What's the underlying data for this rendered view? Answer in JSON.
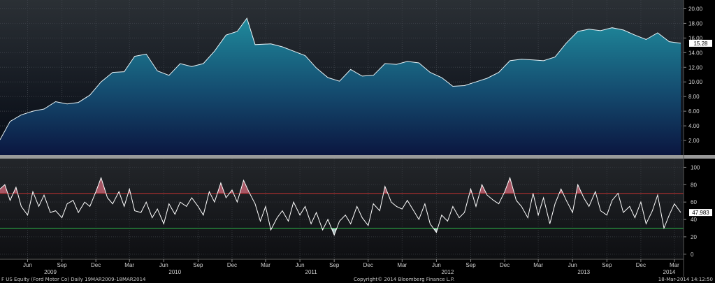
{
  "chart_data": [
    {
      "type": "area",
      "title": "",
      "security": "F US Equity (Ford Motor Co)",
      "periodicity": "Daily",
      "ylim": [
        0,
        21
      ],
      "yticks": [
        2,
        4,
        6,
        8,
        10,
        12,
        14,
        16,
        18,
        20
      ],
      "ytick_labels": [
        "2.00",
        "4.00",
        "6.00",
        "8.00",
        "10.00",
        "12.00",
        "14.00",
        "16.00",
        "18.00",
        "20.00"
      ],
      "last_value": 15.28,
      "last_value_label": "15.28",
      "grid": true,
      "colors": {
        "area_top": "#1f8a9c",
        "area_bottom": "#0b1640",
        "line": "#e8f4f8",
        "background_top": "#2b3035",
        "background_bottom": "#050a14"
      },
      "x": [
        "2009-03-19",
        "2009-04-15",
        "2009-05-15",
        "2009-06-15",
        "2009-07-15",
        "2009-08-15",
        "2009-09-15",
        "2009-10-15",
        "2009-11-15",
        "2009-12-15",
        "2010-01-15",
        "2010-02-15",
        "2010-03-15",
        "2010-04-15",
        "2010-05-15",
        "2010-06-15",
        "2010-07-15",
        "2010-08-15",
        "2010-09-15",
        "2010-10-15",
        "2010-11-15",
        "2010-12-15",
        "2011-01-10",
        "2011-02-01",
        "2011-03-15",
        "2011-04-15",
        "2011-05-15",
        "2011-06-15",
        "2011-07-15",
        "2011-08-15",
        "2011-09-15",
        "2011-10-15",
        "2011-11-15",
        "2011-12-15",
        "2012-01-15",
        "2012-02-15",
        "2012-03-15",
        "2012-04-15",
        "2012-05-15",
        "2012-06-15",
        "2012-07-15",
        "2012-08-15",
        "2012-09-15",
        "2012-10-15",
        "2012-11-15",
        "2012-12-15",
        "2013-01-15",
        "2013-02-15",
        "2013-03-15",
        "2013-04-15",
        "2013-05-15",
        "2013-06-15",
        "2013-07-15",
        "2013-08-15",
        "2013-09-15",
        "2013-10-15",
        "2013-11-15",
        "2013-12-15",
        "2014-01-15",
        "2014-02-15",
        "2014-03-18"
      ],
      "values": [
        2.1,
        4.6,
        5.5,
        6.0,
        6.3,
        7.3,
        7.0,
        7.2,
        8.2,
        10.0,
        11.3,
        11.4,
        13.5,
        13.8,
        11.5,
        10.9,
        12.5,
        12.1,
        12.5,
        14.2,
        16.4,
        16.9,
        18.7,
        15.1,
        15.2,
        14.8,
        14.2,
        13.6,
        11.9,
        10.6,
        10.1,
        11.7,
        10.8,
        10.9,
        12.5,
        12.4,
        12.8,
        12.6,
        11.3,
        10.6,
        9.4,
        9.5,
        10.0,
        10.5,
        11.3,
        12.9,
        13.1,
        13.0,
        12.9,
        13.4,
        15.3,
        16.9,
        17.2,
        17.0,
        17.4,
        17.1,
        16.4,
        15.8,
        16.7,
        15.5,
        15.28
      ]
    },
    {
      "type": "line",
      "title": "",
      "ylim": [
        -5,
        110
      ],
      "yticks": [
        0,
        20,
        40,
        60,
        80,
        100
      ],
      "ytick_labels": [
        "0",
        "20",
        "40",
        "60",
        "80",
        "100"
      ],
      "overbought_level": 70,
      "oversold_level": 30,
      "last_value": 47.983,
      "last_value_label": "47.983",
      "grid": true,
      "colors": {
        "line": "#ffffff",
        "overbought": "#c23030",
        "oversold": "#2fb84a",
        "fill_over": "#c06070",
        "fill_under": "#cfe8e8"
      },
      "x": [
        "2009-03-19",
        "2009-04-01",
        "2009-04-15",
        "2009-05-01",
        "2009-05-15",
        "2009-06-01",
        "2009-06-15",
        "2009-07-01",
        "2009-07-15",
        "2009-08-01",
        "2009-08-15",
        "2009-09-01",
        "2009-09-15",
        "2009-10-01",
        "2009-10-15",
        "2009-11-01",
        "2009-11-15",
        "2009-12-01",
        "2009-12-15",
        "2010-01-01",
        "2010-01-15",
        "2010-02-01",
        "2010-02-15",
        "2010-03-01",
        "2010-03-15",
        "2010-04-01",
        "2010-04-15",
        "2010-05-01",
        "2010-05-15",
        "2010-06-01",
        "2010-06-15",
        "2010-07-01",
        "2010-07-15",
        "2010-08-01",
        "2010-08-15",
        "2010-09-01",
        "2010-09-15",
        "2010-10-01",
        "2010-10-15",
        "2010-11-01",
        "2010-11-15",
        "2010-12-01",
        "2010-12-15",
        "2011-01-01",
        "2011-01-15",
        "2011-02-01",
        "2011-02-15",
        "2011-03-01",
        "2011-03-15",
        "2011-04-01",
        "2011-04-15",
        "2011-05-01",
        "2011-05-15",
        "2011-06-01",
        "2011-06-15",
        "2011-07-01",
        "2011-07-15",
        "2011-08-01",
        "2011-08-15",
        "2011-09-01",
        "2011-09-15",
        "2011-10-01",
        "2011-10-15",
        "2011-11-01",
        "2011-11-15",
        "2011-12-01",
        "2011-12-15",
        "2012-01-01",
        "2012-01-15",
        "2012-02-01",
        "2012-02-15",
        "2012-03-01",
        "2012-03-15",
        "2012-04-01",
        "2012-04-15",
        "2012-05-01",
        "2012-05-15",
        "2012-06-01",
        "2012-06-15",
        "2012-07-01",
        "2012-07-15",
        "2012-08-01",
        "2012-08-15",
        "2012-09-01",
        "2012-09-15",
        "2012-10-01",
        "2012-10-15",
        "2012-11-01",
        "2012-11-15",
        "2012-12-01",
        "2012-12-15",
        "2013-01-01",
        "2013-01-15",
        "2013-02-01",
        "2013-02-15",
        "2013-03-01",
        "2013-03-15",
        "2013-04-01",
        "2013-04-15",
        "2013-05-01",
        "2013-05-15",
        "2013-06-01",
        "2013-06-15",
        "2013-07-01",
        "2013-07-15",
        "2013-08-01",
        "2013-08-15",
        "2013-09-01",
        "2013-09-15",
        "2013-10-01",
        "2013-10-15",
        "2013-11-01",
        "2013-11-15",
        "2013-12-01",
        "2013-12-15",
        "2014-01-01",
        "2014-01-15",
        "2014-02-01",
        "2014-02-15",
        "2014-03-01",
        "2014-03-18"
      ],
      "values": [
        75,
        80,
        62,
        77,
        55,
        45,
        72,
        55,
        68,
        48,
        50,
        42,
        58,
        62,
        48,
        60,
        55,
        72,
        88,
        65,
        58,
        72,
        55,
        75,
        50,
        48,
        60,
        42,
        52,
        35,
        58,
        46,
        60,
        55,
        65,
        55,
        45,
        72,
        60,
        82,
        65,
        74,
        60,
        85,
        72,
        58,
        38,
        55,
        28,
        42,
        50,
        38,
        60,
        45,
        55,
        35,
        48,
        28,
        40,
        22,
        38,
        45,
        35,
        55,
        42,
        33,
        58,
        50,
        78,
        60,
        55,
        52,
        62,
        50,
        40,
        58,
        35,
        25,
        45,
        38,
        55,
        42,
        48,
        75,
        55,
        80,
        68,
        62,
        58,
        72,
        88,
        62,
        55,
        42,
        70,
        45,
        65,
        35,
        58,
        75,
        62,
        48,
        80,
        65,
        55,
        72,
        50,
        45,
        62,
        70,
        48,
        55,
        42,
        60,
        35,
        50,
        68,
        30,
        45,
        58,
        48
      ]
    }
  ],
  "axis": {
    "months": [
      {
        "label": "Jun",
        "date": "2009-06-01"
      },
      {
        "label": "Sep",
        "date": "2009-09-01"
      },
      {
        "label": "Dec",
        "date": "2009-12-01"
      },
      {
        "label": "Mar",
        "date": "2010-03-01"
      },
      {
        "label": "Jun",
        "date": "2010-06-01"
      },
      {
        "label": "Sep",
        "date": "2010-09-01"
      },
      {
        "label": "Dec",
        "date": "2010-12-01"
      },
      {
        "label": "Mar",
        "date": "2011-03-01"
      },
      {
        "label": "Jun",
        "date": "2011-06-01"
      },
      {
        "label": "Sep",
        "date": "2011-09-01"
      },
      {
        "label": "Dec",
        "date": "2011-12-01"
      },
      {
        "label": "Mar",
        "date": "2012-03-01"
      },
      {
        "label": "Jun",
        "date": "2012-06-01"
      },
      {
        "label": "Sep",
        "date": "2012-09-01"
      },
      {
        "label": "Dec",
        "date": "2012-12-01"
      },
      {
        "label": "Mar",
        "date": "2013-03-01"
      },
      {
        "label": "Jun",
        "date": "2013-06-01"
      },
      {
        "label": "Sep",
        "date": "2013-09-01"
      },
      {
        "label": "Dec",
        "date": "2013-12-01"
      },
      {
        "label": "Mar",
        "date": "2014-03-01"
      }
    ],
    "years": [
      {
        "label": "2009",
        "date": "2009-08-01"
      },
      {
        "label": "2010",
        "date": "2010-07-01"
      },
      {
        "label": "2011",
        "date": "2011-07-01"
      },
      {
        "label": "2012",
        "date": "2012-07-01"
      },
      {
        "label": "2013",
        "date": "2013-07-01"
      },
      {
        "label": "2014",
        "date": "2014-02-15"
      }
    ],
    "start": "2009-03-19",
    "end": "2014-03-18"
  },
  "footer": {
    "left": "F US Equity (Ford Motor Co)  Daily 19MAR2009-18MAR2014",
    "center": "Copyright© 2014 Bloomberg Finance L.P.",
    "right": "18-Mar-2014 14:12:50"
  }
}
